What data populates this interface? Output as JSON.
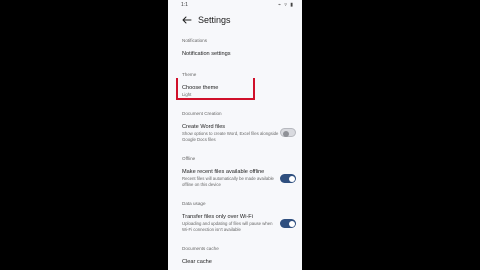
{
  "status": {
    "time": "1:1",
    "icons": "⌁ ▿ ▮"
  },
  "appbar": {
    "title": "Settings"
  },
  "sections": {
    "notifications": {
      "header": "Notifications",
      "item": "Notification settings"
    },
    "theme": {
      "header": "Theme",
      "item": "Choose theme",
      "value": "Light"
    },
    "document_creation": {
      "header": "Document Creation",
      "item": "Create Word files",
      "sub": "Show options to create Word, Excel files alongside Google Docs files",
      "toggle": false
    },
    "offline": {
      "header": "Offline",
      "item": "Make recent files available offline",
      "sub": "Recent files will automatically be made available offline on this device",
      "toggle": true
    },
    "data_usage": {
      "header": "Data usage",
      "item": "Transfer files only over Wi-Fi",
      "sub": "Uploading and updating of files will pause when Wi-Fi connection isn't available",
      "toggle": true
    },
    "documents_cache": {
      "header": "Documents cache",
      "item": "Clear cache"
    }
  },
  "colors": {
    "highlight": "#d0102a",
    "toggle_on": "#2f4f7f",
    "toggle_off": "#d9dadf"
  }
}
